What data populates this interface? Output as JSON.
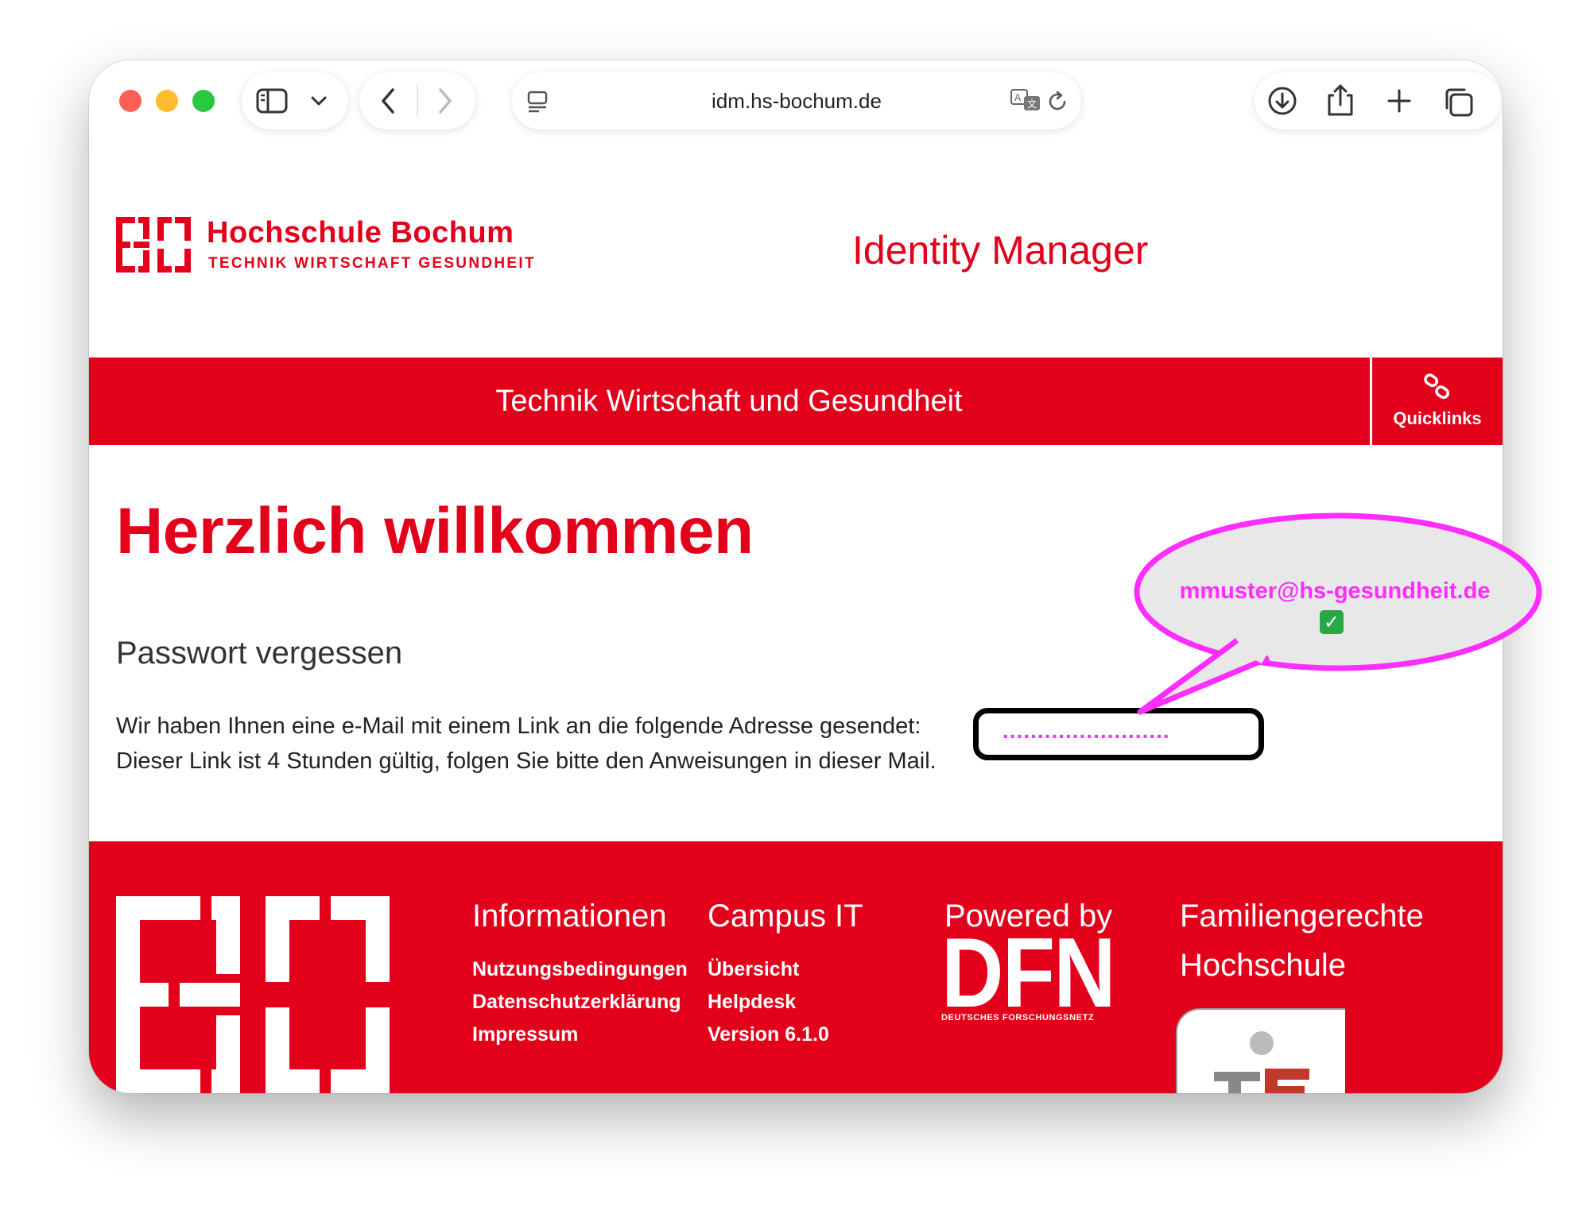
{
  "browser": {
    "url": "idm.hs-bochum.de"
  },
  "header": {
    "logo_title": "Hochschule Bochum",
    "logo_subtitle": "TECHNIK WIRTSCHAFT GESUNDHEIT",
    "app_title": "Identity Manager"
  },
  "nav": {
    "title": "Technik Wirtschaft und Gesundheit",
    "quicklinks_label": "Quicklinks",
    "quicklinks_icon": "link-icon"
  },
  "main": {
    "welcome": "Herzlich willkommen",
    "subtitle": "Passwort vergessen",
    "message_line1": "Wir haben Ihnen eine e-Mail mit einem Link an die folgende Adresse gesendet:",
    "message_line2": "Dieser Link ist 4 Stunden gültig, folgen Sie bitte den Anweisungen in dieser Mail.",
    "redacted_email": "........................"
  },
  "callout": {
    "email": "mmuster@hs-gesundheit.de",
    "check": "✓",
    "color": "#ff2dff"
  },
  "footer": {
    "columns": [
      {
        "heading": "Informationen",
        "links": [
          "Nutzungsbedingungen",
          "Datenschutzerklärung",
          "Impressum"
        ]
      },
      {
        "heading": "Campus IT",
        "links": [
          "Übersicht",
          "Helpdesk",
          "Version 6.1.0"
        ]
      },
      {
        "heading": "Powered by"
      }
    ],
    "family_heading_line1": "Familiengerechte",
    "family_heading_line2": "Hochschule",
    "dfn_logo_text": "DFN",
    "dfn_logo_subtext": "DEUTSCHES FORSCHUNGSNETZ"
  },
  "colors": {
    "brand_red": "#e2001a",
    "callout_magenta": "#ff2dff"
  }
}
